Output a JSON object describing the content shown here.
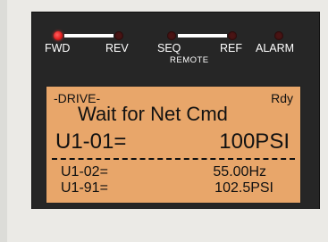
{
  "indicators": {
    "fwd": {
      "label": "FWD",
      "lit": true
    },
    "rev": {
      "label": "REV",
      "lit": false
    },
    "seq": {
      "label": "SEQ",
      "lit": false
    },
    "ref": {
      "label": "REF",
      "lit": false
    },
    "alarm": {
      "label": "ALARM",
      "lit": false
    },
    "remote_label": "REMOTE"
  },
  "lcd": {
    "mode": "-DRIVE-",
    "status": "Rdy",
    "message": "Wait for Net Cmd",
    "primary_param": "U1-01=",
    "primary_value": "100PSI",
    "rows": [
      {
        "param": "U1-02=",
        "value": "55.00Hz"
      },
      {
        "param": "U1-91=",
        "value": "102.5PSI"
      }
    ]
  },
  "colors": {
    "lcd_background": "#e8a66a",
    "panel_background": "#262626",
    "led_on": "#e21c1c",
    "led_off": "#4a1414"
  }
}
